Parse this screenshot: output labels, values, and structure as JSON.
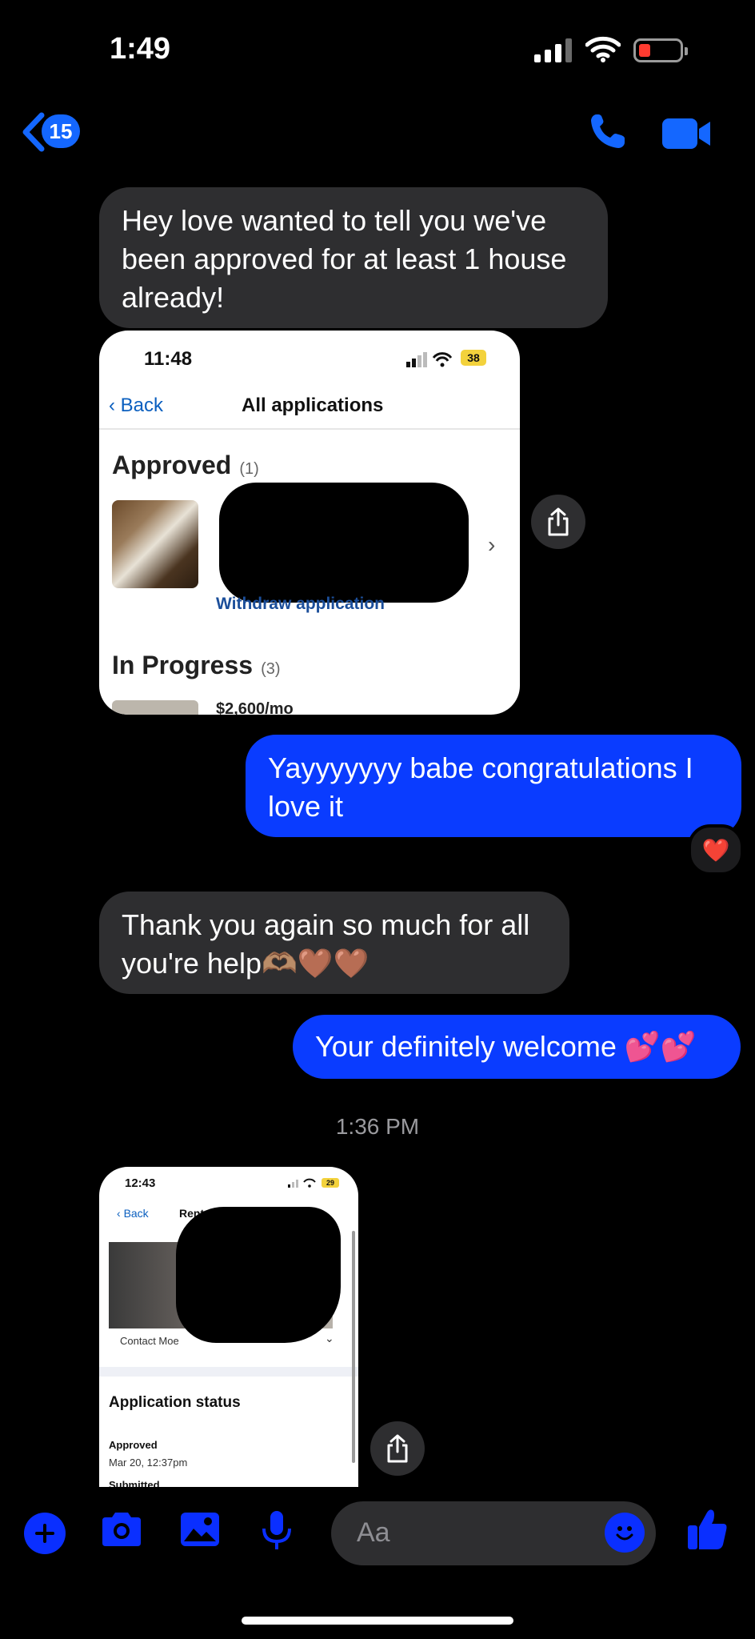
{
  "status_bar": {
    "time": "1:49"
  },
  "nav": {
    "back_count": "15"
  },
  "messages": {
    "m1": "Hey love wanted to tell you we've been approved for at least 1 house already!",
    "m3": "Yayyyyyyy babe congratulations I love it",
    "m3_reaction": "❤️",
    "m4": "Thank you again so much for all you're help🫶🏽🤎🤎",
    "m5": "Your definitely welcome 💕💕",
    "timestamp": "1:36 PM"
  },
  "card1": {
    "time": "11:48",
    "battery": "38",
    "back": "Back",
    "title": "All applications",
    "approved_label": "Approved",
    "approved_count": "(1)",
    "withdraw": "Withdraw application",
    "in_progress_label": "In Progress",
    "in_progress_count": "(3)",
    "price": "$2,600/mo"
  },
  "card2": {
    "time": "12:43",
    "battery": "29",
    "back": "Back",
    "title": "Rental Application",
    "contact": "Contact Moe",
    "status_heading": "Application status",
    "approved": "Approved",
    "approved_date": "Mar 20, 12:37pm",
    "submitted": "Submitted"
  },
  "composer": {
    "placeholder": "Aa"
  },
  "colors": {
    "accent": "#0a3cff",
    "incoming_bubble": "#2e2e30",
    "background": "#000000"
  }
}
